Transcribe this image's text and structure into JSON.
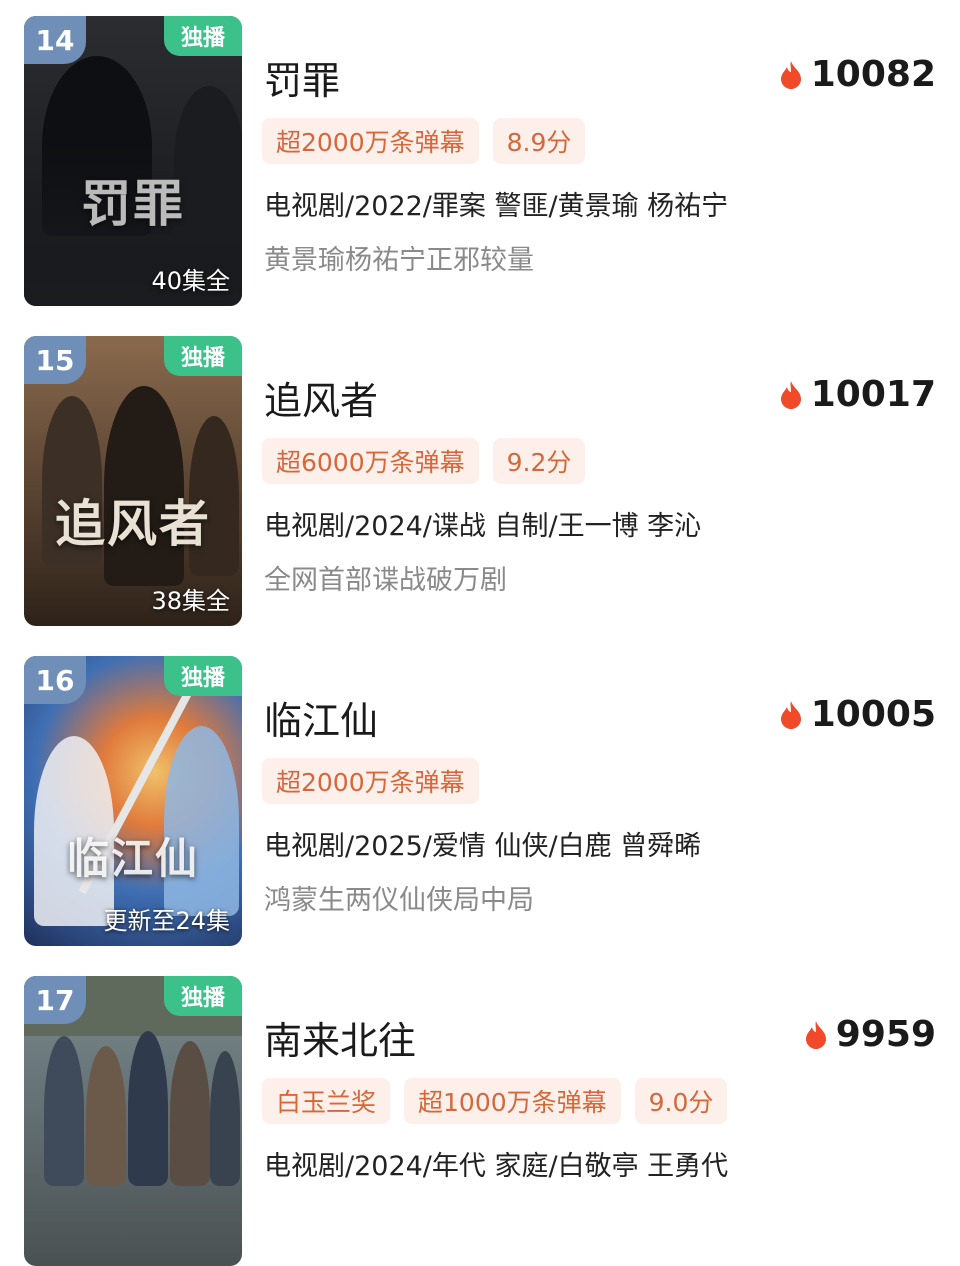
{
  "items": [
    {
      "rank": "14",
      "badge": "独播",
      "poster_title": "罚罪",
      "episodes": "40集全",
      "title": "罚罪",
      "heat": "10082",
      "tags": [
        "超2000万条弹幕",
        "8.9分"
      ],
      "meta": "电视剧/2022/罪案 警匪/黄景瑜 杨祐宁",
      "desc": "黄景瑜杨祐宁正邪较量",
      "colors": {
        "poster_top": "#2b2d31",
        "poster_bottom": "#141518"
      }
    },
    {
      "rank": "15",
      "badge": "独播",
      "poster_title": "追风者",
      "episodes": "38集全",
      "title": "追风者",
      "heat": "10017",
      "tags": [
        "超6000万条弹幕",
        "9.2分"
      ],
      "meta": "电视剧/2024/谍战 自制/王一博 李沁",
      "desc": "全网首部谍战破万剧",
      "colors": {
        "poster_top": "#8a6a4e",
        "poster_bottom": "#2e2219"
      }
    },
    {
      "rank": "16",
      "badge": "独播",
      "poster_title": "临江仙",
      "episodes": "更新至24集",
      "title": "临江仙",
      "heat": "10005",
      "tags": [
        "超2000万条弹幕"
      ],
      "meta": "电视剧/2025/爱情 仙侠/白鹿 曾舜晞",
      "desc": "鸿蒙生两仪仙侠局中局",
      "colors": {
        "poster_top": "#3f6fb4",
        "poster_bottom": "#c9533a"
      }
    },
    {
      "rank": "17",
      "badge": "独播",
      "poster_title": "",
      "episodes": "",
      "title": "南来北往",
      "heat": "9959",
      "tags": [
        "白玉兰奖",
        "超1000万条弹幕",
        "9.0分"
      ],
      "meta": "电视剧/2024/年代 家庭/白敬亭 王勇代",
      "desc": "",
      "colors": {
        "poster_top": "#7a8a8e",
        "poster_bottom": "#4a5152"
      }
    }
  ],
  "colors": {
    "accent_tag_bg": "#fdf0ea",
    "accent_tag_text": "#d5683a",
    "exclusive_green": "#3cc18a",
    "rank_blue": "#6f8fb8",
    "flame_red": "#f04a2b"
  }
}
